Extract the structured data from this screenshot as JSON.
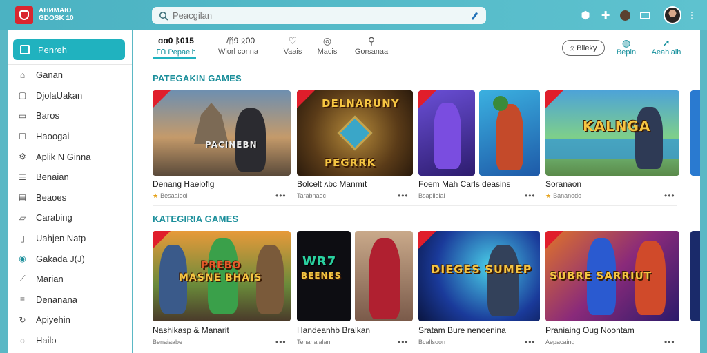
{
  "app": {
    "title_line1": "АНИМАЮ",
    "title_line2": "GDOSK 10"
  },
  "search": {
    "placeholder": "Peacgilan"
  },
  "colors": {
    "accent": "#20b2bf",
    "header": "#4bb2c2",
    "ribbon": "#e01e2b"
  },
  "sidebar": {
    "active": "Penreh",
    "items": [
      {
        "label": "Ganan",
        "icon": "home-icon"
      },
      {
        "label": "DjolaUakan",
        "icon": "grid-icon"
      },
      {
        "label": "Baros",
        "icon": "square-icon"
      },
      {
        "label": "Haoogai",
        "icon": "box-icon"
      },
      {
        "label": "Aplik N Ginna",
        "icon": "settings-icon"
      },
      {
        "label": "Benaian",
        "icon": "list-icon"
      },
      {
        "label": "Beaoes",
        "icon": "bookmark-icon"
      },
      {
        "label": "Carabing",
        "icon": "folder-icon"
      },
      {
        "label": "Uahjen Natp",
        "icon": "doc-icon"
      },
      {
        "label": "Gakada J(J)",
        "icon": "target-icon"
      },
      {
        "label": "Marian",
        "icon": "link-icon"
      },
      {
        "label": "Denanana",
        "icon": "menu-icon"
      },
      {
        "label": "Apiyehin",
        "icon": "refresh-icon"
      },
      {
        "label": "Hailo",
        "icon": "bulb-icon"
      }
    ]
  },
  "tabs": [
    {
      "top": "ɑɑ0 ᛒ015",
      "label": "ᒥᑎ Pepaelh"
    },
    {
      "top": "ᛁ/ᛗ9 ᛟ00",
      "label": "Wiorl conna"
    },
    {
      "top": "♡",
      "label": "Vaais"
    },
    {
      "top": "◎",
      "label": "Macis"
    },
    {
      "top": "⚲",
      "label": "Gorsanaa"
    }
  ],
  "toolbar": {
    "pill": "ᛟ Blieky",
    "tool1": "Bepin",
    "tool2": "Aeahiaih"
  },
  "sections": [
    {
      "title": "PATEGAKIN GAMES",
      "cards": [
        {
          "title": "Denang Haeioflg",
          "sub": "Besaaiooi",
          "overlay": "PACINEBN",
          "rating": "★"
        },
        {
          "title": "Bolcelt ʌbc Manmıt",
          "sub": "Tarabnaoc",
          "overlay": "PEGRRK",
          "overlay2": "DELNARUNY",
          "rating": ""
        },
        {
          "title": "Foem Mah Carls deasins",
          "sub": "Bsaplioiai",
          "overlay": "",
          "rating": ""
        },
        {
          "title": "Soranaon",
          "sub": "Bananodo",
          "overlay": "KALNGA",
          "rating": "★"
        }
      ]
    },
    {
      "title": "KATEGIRIA GAMES",
      "cards": [
        {
          "title": "Nashikasp & Manarit",
          "sub": "Benaiaabe",
          "overlay": "MASNE BHAIS",
          "overlay2": "PREBO",
          "rating": ""
        },
        {
          "title": "Handeanhb Bralkan",
          "sub": "Tenanaialan",
          "overlay": "BEENES",
          "overlay2": "WR7",
          "rating": ""
        },
        {
          "title": "Sratam Bure nenoenina",
          "sub": "Bcallsoon",
          "overlay": "DIEGES SUMEP",
          "rating": ""
        },
        {
          "title": "Praniaing Oug Noontam",
          "sub": "Aepacaing",
          "overlay": "SUBRE SARRIUT",
          "rating": ""
        }
      ]
    }
  ],
  "more_label": "•••"
}
